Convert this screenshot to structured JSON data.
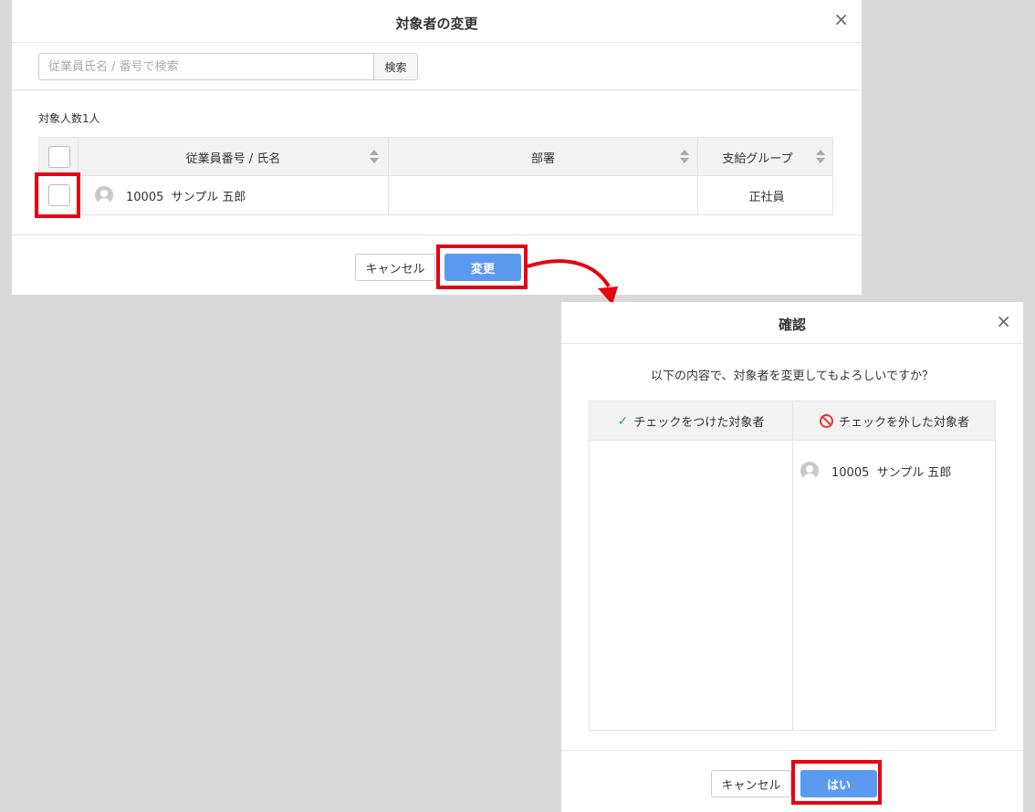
{
  "dialog1": {
    "title": "対象者の変更",
    "close": "×",
    "search": {
      "placeholder": "従業員氏名 / 番号で検索",
      "value": "",
      "button": "検索"
    },
    "count_label": "対象人数1人",
    "table": {
      "columns": [
        "従業員番号 / 氏名",
        "部署",
        "支給グループ"
      ],
      "rows": [
        {
          "employee": "10005  サンプル 五郎",
          "department": "",
          "pay_group": "正社員",
          "checked": false
        }
      ]
    },
    "cancel": "キャンセル",
    "change": "変更"
  },
  "dialog2": {
    "title": "確認",
    "close": "×",
    "question": "以下の内容で、対象者を変更してもよろしいですか？",
    "columns": {
      "checked": "チェックをつけた対象者",
      "unchecked": "チェックを外した対象者"
    },
    "checked_items": [],
    "unchecked_items": [
      "10005  サンプル 五郎"
    ],
    "cancel": "キャンセル",
    "yes": "はい"
  },
  "colors": {
    "primary": "#5b9bef",
    "highlight": "#e60012",
    "check": "#3aa35b",
    "ban": "#e3342f"
  }
}
